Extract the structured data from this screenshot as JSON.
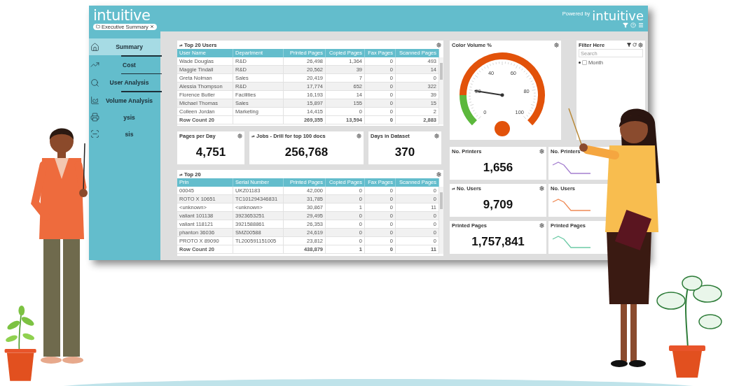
{
  "header": {
    "logo": "intuitive",
    "tab": {
      "label": "Executive Summary",
      "selected": true
    },
    "powered_by": "Powered by",
    "brand": "intuitive"
  },
  "sidebar": {
    "items": [
      {
        "label": "Summary",
        "selected": true
      },
      {
        "label": "Cost",
        "selected": false
      },
      {
        "label": "User Analysis",
        "selected": false
      },
      {
        "label": "Volume Analysis",
        "selected": false
      },
      {
        "label": "ysis",
        "selected": false
      },
      {
        "label": "sis",
        "selected": false
      }
    ]
  },
  "top_users": {
    "title": "Top 20 Users",
    "drill": true,
    "columns": [
      "User Name",
      "Department",
      "Printed Pages",
      "Copied Pages",
      "Fax Pages",
      "Scanned Pages"
    ],
    "rows": [
      [
        "Wade Douglas",
        "R&D",
        "26,498",
        "1,364",
        "0",
        "493"
      ],
      [
        "Maggie Tindall",
        "R&D",
        "20,562",
        "39",
        "0",
        "14"
      ],
      [
        "Greta Nolman",
        "Sales",
        "20,419",
        "7",
        "0",
        "0"
      ],
      [
        "Alessia Thompson",
        "R&D",
        "17,774",
        "652",
        "0",
        "322"
      ],
      [
        "Florence Butler",
        "Facilities",
        "16,193",
        "14",
        "0",
        "39"
      ],
      [
        "Michael Thomas",
        "Sales",
        "15,897",
        "155",
        "0",
        "15"
      ],
      [
        "Colleen Jordan",
        "Marketing",
        "14,415",
        "0",
        "0",
        "2"
      ]
    ],
    "total": {
      "label": "Row Count 20",
      "values": [
        "269,355",
        "13,594",
        "0",
        "2,883"
      ]
    }
  },
  "kpis": [
    {
      "title": "Pages per Day",
      "drill": false,
      "value": "4,751"
    },
    {
      "title": "Jobs - Drill for top 100 docs",
      "drill": true,
      "value": "256,768"
    },
    {
      "title": "Days in Dataset",
      "drill": false,
      "value": "370"
    }
  ],
  "top_printers": {
    "title": "Top 20",
    "drill": true,
    "columns": [
      "Prin",
      "Serial Number",
      "Printed Pages",
      "Copied Pages",
      "Fax Pages",
      "Scanned Pages"
    ],
    "rows": [
      [
        "00045",
        "UKZ01183",
        "42,000",
        "0",
        "0",
        "0"
      ],
      [
        "ROTO X 10651",
        "TC101294346831",
        "31,785",
        "0",
        "0",
        "0"
      ],
      [
        "<unknown>",
        "<unknown>",
        "30,867",
        "1",
        "0",
        "11"
      ],
      [
        "valiant 101138",
        "3923653251",
        "29,495",
        "0",
        "0",
        "0"
      ],
      [
        "valiant 118121",
        "3921588861",
        "26,353",
        "0",
        "0",
        "0"
      ],
      [
        "phanton 36036",
        "SMZ00588",
        "24,619",
        "0",
        "0",
        "0"
      ],
      [
        "PROTO X 89090",
        "TL200591151005",
        "23,812",
        "0",
        "0",
        "0"
      ]
    ],
    "total": {
      "label": "Row Count 20",
      "values": [
        "438,879",
        "1",
        "0",
        "11"
      ]
    }
  },
  "gauge": {
    "title": "Color Volume %",
    "ticks": [
      "0",
      "20",
      "40",
      "60",
      "80",
      "100"
    ],
    "level": 0.2
  },
  "filter": {
    "title": "Filter Here",
    "search": {
      "placeholder": "Search"
    },
    "items": [
      {
        "label": "Month",
        "checked": false
      }
    ]
  },
  "metrics": [
    {
      "title": "No. Printers",
      "drill": false,
      "value": "1,656",
      "trend_title": "No. Printers",
      "color": "#a57fd0"
    },
    {
      "title": "No. Users",
      "drill": true,
      "value": "9,709",
      "trend_title": "No. Users",
      "color": "#ef8a55"
    },
    {
      "title": "Printed Pages",
      "drill": false,
      "value": "1,757,841",
      "trend_title": "Printed Pages",
      "color": "#6ccaa6"
    }
  ]
}
